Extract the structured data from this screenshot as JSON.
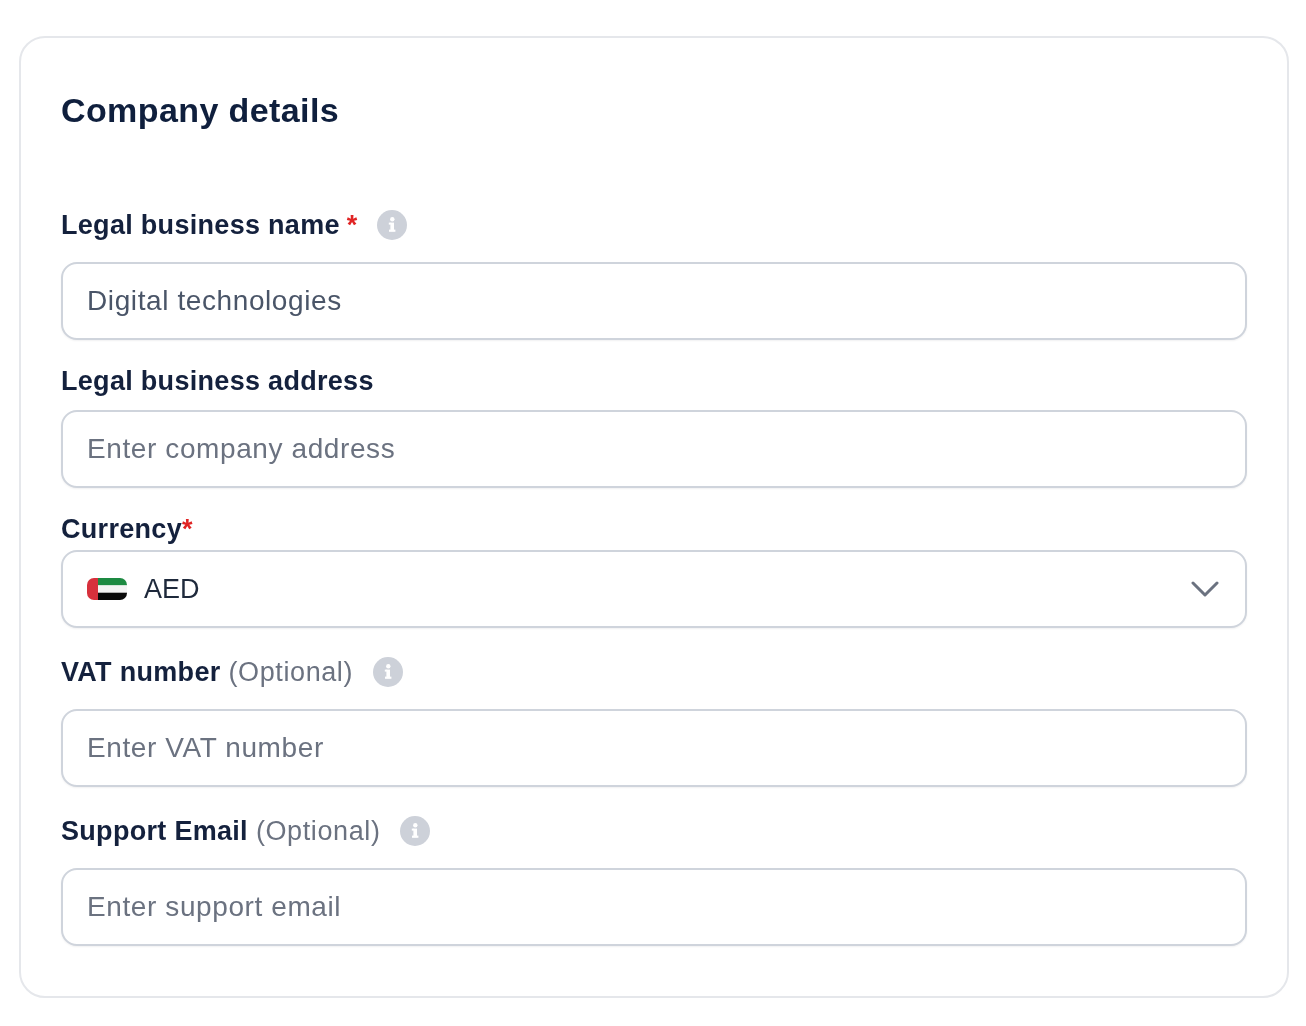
{
  "card": {
    "title": "Company details"
  },
  "fields": [
    {
      "kind": "text",
      "label": "Legal business name",
      "required_mark": "*",
      "info_icon": true,
      "value": "Digital technologies"
    },
    {
      "kind": "text",
      "label": "Legal business address",
      "info_icon": false,
      "placeholder": "Enter company address"
    },
    {
      "kind": "select",
      "label": "Currency",
      "required_mark": "*",
      "info_icon": false,
      "value": "AED"
    },
    {
      "kind": "text",
      "label": "VAT number",
      "optional_note": "(Optional)",
      "info_icon": true,
      "placeholder": "Enter VAT number"
    },
    {
      "kind": "text",
      "label": "Support Email",
      "optional_note": "(Optional)",
      "info_icon": true,
      "placeholder": "Enter support email"
    }
  ]
}
